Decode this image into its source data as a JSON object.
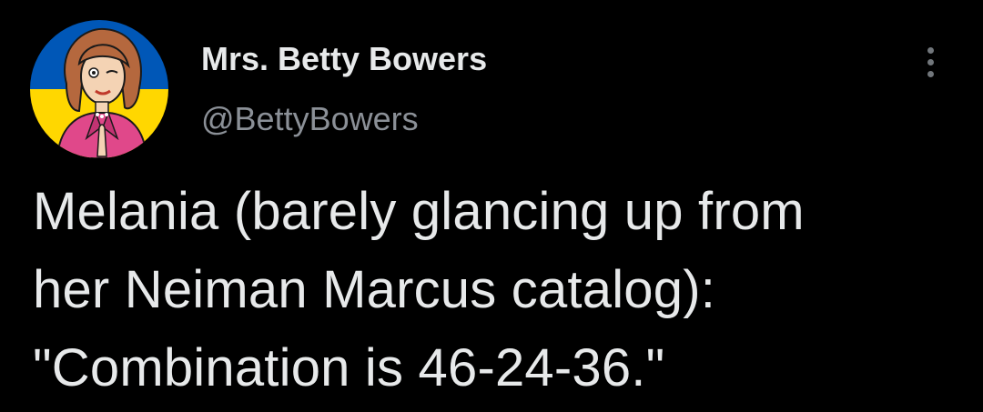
{
  "author": {
    "display_name": "Mrs. Betty Bowers",
    "handle": "@BettyBowers",
    "avatar_icon": "cartoon-woman-avatar-icon",
    "avatar_flag_colors": [
      "#0057b7",
      "#ffd700"
    ]
  },
  "menu": {
    "icon": "more-options-icon"
  },
  "tweet": {
    "lines": [
      "Melania (barely glancing up from",
      "her Neiman Marcus catalog):",
      "\"Combination is 46-24-36.\""
    ]
  },
  "colors": {
    "background": "#000000",
    "primary_text": "#e7e9ea",
    "secondary_text": "#8b9097"
  }
}
